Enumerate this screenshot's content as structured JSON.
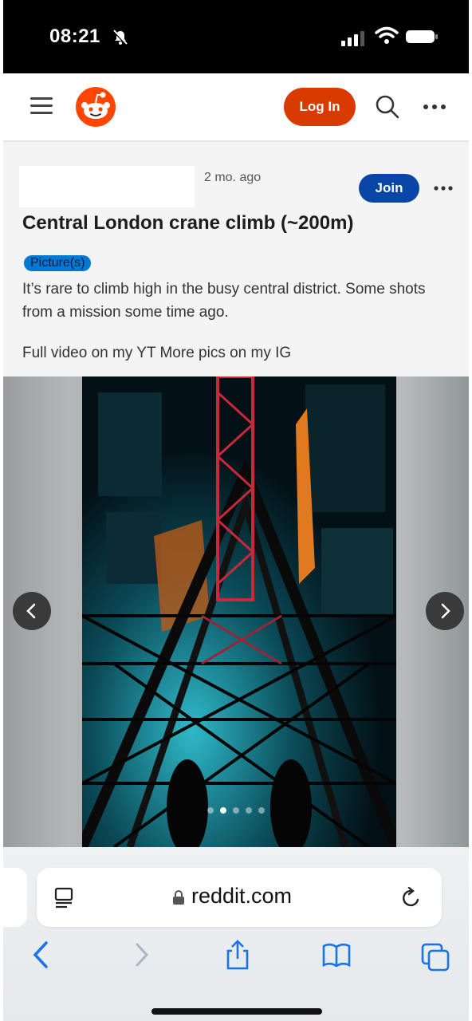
{
  "status_bar": {
    "time": "08:21"
  },
  "header": {
    "login_label": "Log In"
  },
  "post": {
    "age": "2 mo. ago",
    "join_label": "Join",
    "title": "Central London crane climb (~200m)",
    "flair": "Picture(s)",
    "body": "It’s rare to climb high in the busy central district. Some shots from a mission some time ago.",
    "links": "Full video on my YT More pics on my IG"
  },
  "gallery": {
    "image_count": 5,
    "current_index": 2
  },
  "browser": {
    "url": "reddit.com"
  },
  "colors": {
    "reddit_orange": "#ff4500",
    "login": "#d93a00",
    "join": "#0a45a8",
    "flair": "#0079d3",
    "safari_blue": "#1a73e8"
  },
  "icons": [
    "mute-bell-icon",
    "signal-icon",
    "wifi-icon",
    "battery-icon",
    "menu-icon",
    "reddit-logo-icon",
    "search-icon",
    "more-icon",
    "chevron-left-icon",
    "chevron-right-icon",
    "reader-icon",
    "lock-icon",
    "reload-icon",
    "back-icon",
    "forward-icon",
    "share-icon",
    "bookmarks-icon",
    "tabs-icon"
  ]
}
